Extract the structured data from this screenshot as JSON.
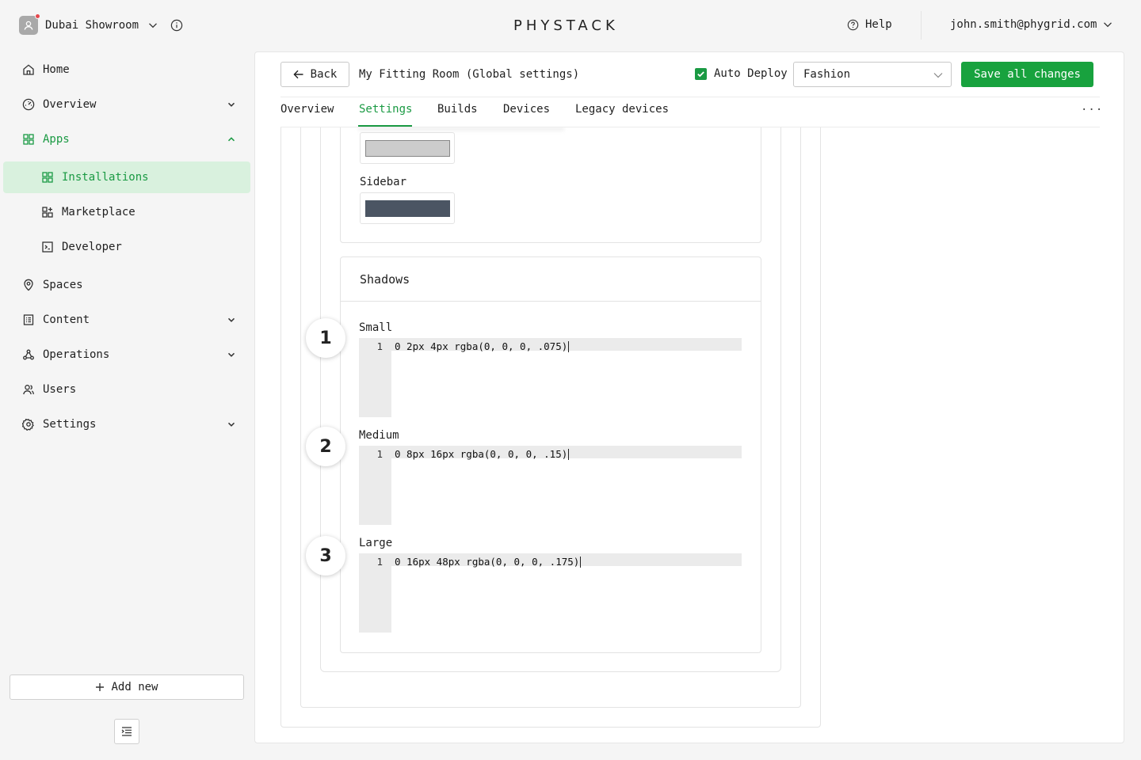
{
  "header": {
    "org_name": "Dubai Showroom",
    "logo": "PHYSTACK",
    "help_label": "Help",
    "user_email": "john.smith@phygrid.com"
  },
  "sidebar": {
    "items": [
      {
        "label": "Home",
        "icon": "home-icon"
      },
      {
        "label": "Overview",
        "icon": "dashboard-icon"
      },
      {
        "label": "Apps",
        "icon": "apps-grid-icon"
      },
      {
        "label": "Installations",
        "icon": "apps-grid-icon"
      },
      {
        "label": "Marketplace",
        "icon": "marketplace-icon"
      },
      {
        "label": "Developer",
        "icon": "terminal-icon"
      },
      {
        "label": "Spaces",
        "icon": "location-pin-icon"
      },
      {
        "label": "Content",
        "icon": "content-icon"
      },
      {
        "label": "Operations",
        "icon": "operations-icon"
      },
      {
        "label": "Users",
        "icon": "users-icon"
      },
      {
        "label": "Settings",
        "icon": "gear-icon"
      }
    ],
    "add_new_label": "Add new"
  },
  "toolbar": {
    "back_label": "Back",
    "title": "My Fitting Room (Global settings)",
    "auto_deploy_label": "Auto Deploy",
    "auto_deploy_checked": true,
    "theme_select_value": "Fashion",
    "save_label": "Save all changes"
  },
  "tabs": [
    {
      "label": "Overview",
      "active": false
    },
    {
      "label": "Settings",
      "active": true
    },
    {
      "label": "Builds",
      "active": false
    },
    {
      "label": "Devices",
      "active": false
    },
    {
      "label": "Legacy devices",
      "active": false
    }
  ],
  "content": {
    "sidebar_color_label": "Sidebar",
    "top_swatch_color": "#cccccc",
    "sidebar_swatch_color": "#4b5563",
    "shadows_title": "Shadows",
    "shadows": [
      {
        "step": "1",
        "label": "Small",
        "line_number": "1",
        "value": "0 2px 4px rgba(0, 0, 0, .075)"
      },
      {
        "step": "2",
        "label": "Medium",
        "line_number": "1",
        "value": "0 8px 16px rgba(0, 0, 0, .15)"
      },
      {
        "step": "3",
        "label": "Large",
        "line_number": "1",
        "value": "0 16px 48px rgba(0, 0, 0, .175)"
      }
    ]
  },
  "colors": {
    "accent": "#1a9a43",
    "save_button": "#18a23e",
    "selected_nav_bg": "#d9f1de"
  }
}
